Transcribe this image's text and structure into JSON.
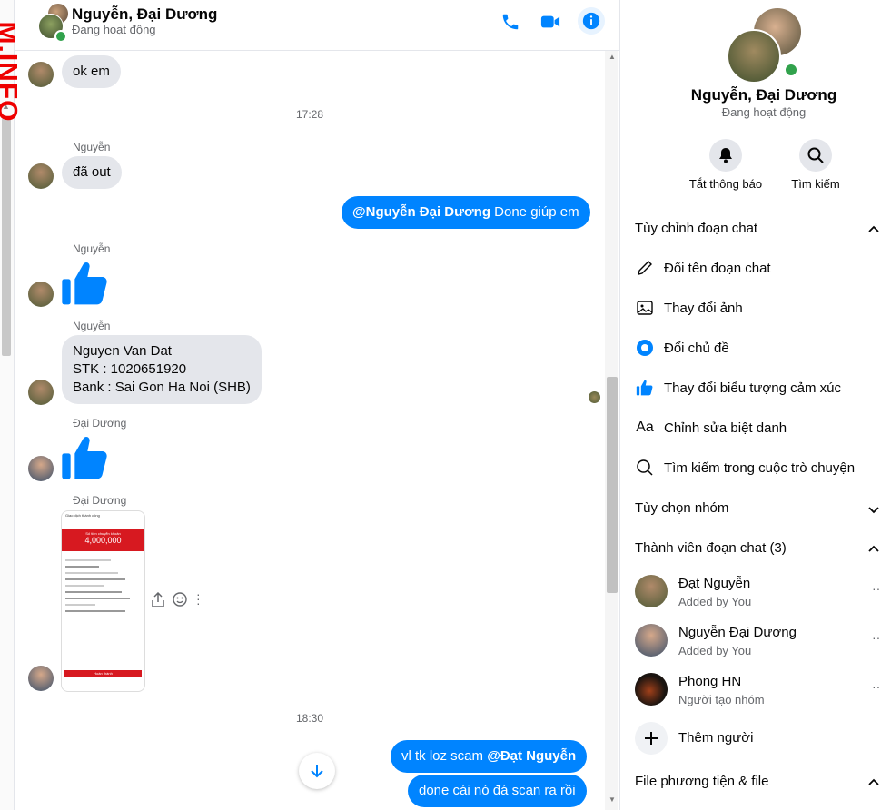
{
  "header": {
    "name": "Nguyễn, Đại Dương",
    "status": "Đang hoạt động"
  },
  "watermark": "M.INFO",
  "messages": {
    "m1_text": "ok em",
    "time1": "17:28",
    "m2_sender": "Nguyễn",
    "m2_text": "đã out",
    "m3_mention": "@Nguyễn Đại Dương",
    "m3_text": " Done giúp em",
    "m4_sender": "Nguyễn",
    "m5_sender": "Nguyễn",
    "m5_lines": [
      "Nguyen Van Dat",
      "STK : 1020651920",
      "Bank : Sai Gon Ha Noi (SHB)"
    ],
    "m6_sender": "Đại Dương",
    "m7_sender": "Đại Dương",
    "receipt": {
      "header": "Giao dịch thành công",
      "amount_label": "Số tiền chuyển khoản",
      "amount": "4,000,000",
      "button": "Hoàn thành"
    },
    "time2": "18:30",
    "m8_text": "vl tk loz scam ",
    "m8_mention": "@Đạt Nguyễn",
    "m9_text": "done cái nó đá scan ra rồi"
  },
  "right_panel": {
    "name": "Nguyễn, Đại Dương",
    "status": "Đang hoạt động",
    "mute_label": "Tắt thông báo",
    "search_label": "Tìm kiếm",
    "customize_title": "Tùy chỉnh đoạn chat",
    "rename": "Đổi tên đoạn chat",
    "change_photo": "Thay đổi ảnh",
    "change_theme": "Đổi chủ đề",
    "change_emoji": "Thay đổi biểu tượng cảm xúc",
    "nicknames": "Chỉnh sửa biệt danh",
    "search_convo": "Tìm kiếm trong cuộc trò chuyện",
    "group_options": "Tùy chọn nhóm",
    "members_title": "Thành viên đoạn chat (3)",
    "members": [
      {
        "name": "Đạt Nguyễn",
        "sub": "Added by You"
      },
      {
        "name": "Nguyễn Đại Dương",
        "sub": "Added by You"
      },
      {
        "name": "Phong HN",
        "sub": "Người tạo nhóm"
      }
    ],
    "add_people": "Thêm người",
    "media_title": "File phương tiện & file"
  },
  "colors": {
    "accent": "#0084ff",
    "bubble_in": "#e4e6eb",
    "online": "#31a24c",
    "receipt_red": "#d71920"
  },
  "icons": [
    "phone-icon",
    "video-icon",
    "info-icon",
    "bell-icon",
    "search-icon",
    "pencil-icon",
    "image-icon",
    "theme-icon",
    "like-icon",
    "text-icon",
    "chevron-up-icon",
    "chevron-down-icon",
    "plus-icon",
    "more-icon",
    "share-icon",
    "emoji-icon",
    "arrow-down-icon"
  ]
}
